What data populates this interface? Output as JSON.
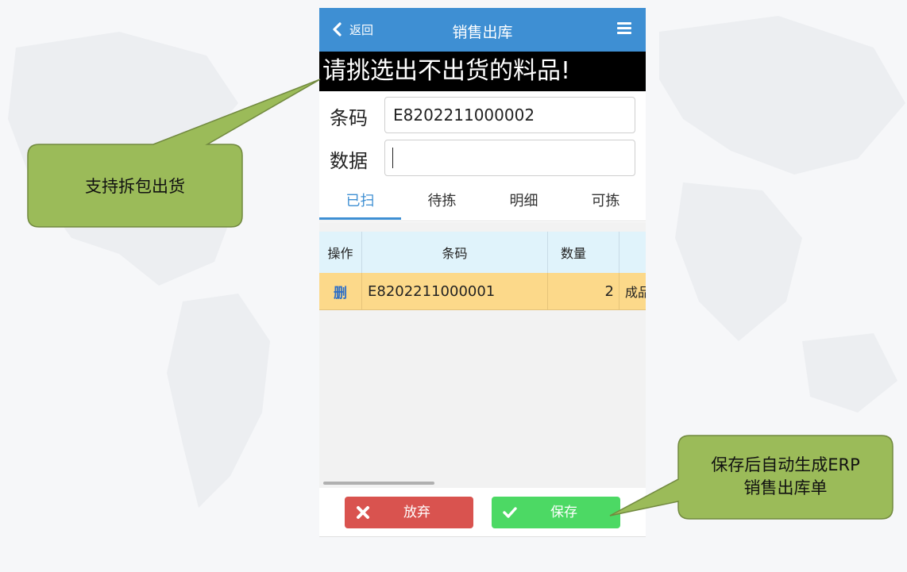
{
  "colors": {
    "nav_blue": "#3e8fd3",
    "banner_bg": "#000000",
    "grid_header_bg": "#e0f3fb",
    "selected_row_bg": "#fcd98a",
    "abandon_red": "#d9534f",
    "save_green": "#4cd964",
    "callout_green": "#9bbb59"
  },
  "nav": {
    "back_label": "返回",
    "title": "销售出库",
    "back_icon": "chevron-left-icon",
    "menu_icon": "hamburger-menu-icon"
  },
  "banner": {
    "text": "请挑选出不出货的料品!"
  },
  "form": {
    "barcode_label": "条码",
    "barcode_value": "E8202211000002",
    "data_label": "数据",
    "data_value": ""
  },
  "tabs": [
    {
      "label": "已扫",
      "active": true
    },
    {
      "label": "待拣",
      "active": false
    },
    {
      "label": "明细",
      "active": false
    },
    {
      "label": "可拣",
      "active": false
    }
  ],
  "grid": {
    "columns": [
      "操作",
      "条码",
      "数量",
      ""
    ],
    "rows": [
      {
        "action": "删",
        "barcode": "E8202211000001",
        "qty": "2",
        "more": "成品"
      }
    ]
  },
  "buttons": {
    "abandon_label": "放弃",
    "abandon_icon": "x-icon",
    "save_label": "保存",
    "save_icon": "checkmark-icon"
  },
  "callouts": {
    "left_text": "支持拆包出货",
    "right_line1": "保存后自动生成ERP",
    "right_line2": "销售出库单"
  }
}
